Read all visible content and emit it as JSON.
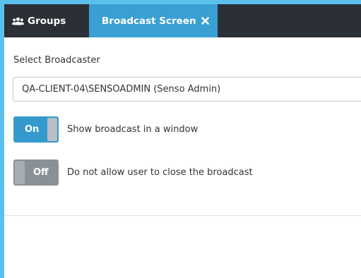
{
  "tabs": [
    {
      "label": "Groups",
      "icon": "users-icon",
      "active": false
    },
    {
      "label": "Broadcast Screen",
      "icon": "close-icon",
      "active": true
    }
  ],
  "form": {
    "broadcaster_label": "Select Broadcaster",
    "broadcaster_value": "QA-CLIENT-04\\SENSOADMIN (Senso Admin)",
    "toggles": [
      {
        "state": "On",
        "label": "Show broadcast in a window"
      },
      {
        "state": "Off",
        "label": "Do not allow user to close the broadcast"
      }
    ]
  },
  "colors": {
    "tabbar_bg": "#2b2f36",
    "active_tab": "#3aa0d4",
    "toggle_on": "#3499cc",
    "toggle_off": "#8a9196",
    "frame": "#5bc0ec"
  }
}
